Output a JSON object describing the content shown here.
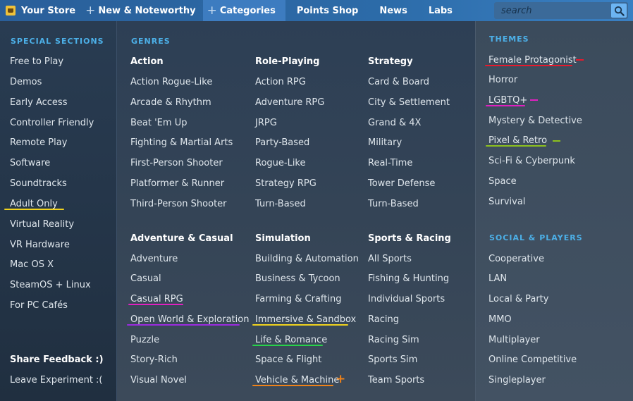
{
  "colors": {
    "yellow": "#f0d21e",
    "red": "#e8192c",
    "magenta": "#e020c0",
    "purple": "#9b2be0",
    "green": "#28d24a",
    "orange": "#f08218",
    "olive": "#8cc01e"
  },
  "topnav": {
    "store_label": "Your Store",
    "new_label": "New & Noteworthy",
    "categories_label": "Categories",
    "points_label": "Points Shop",
    "news_label": "News",
    "labs_label": "Labs",
    "search_placeholder": "search"
  },
  "special": {
    "heading": "SPECIAL SECTIONS",
    "items": [
      "Free to Play",
      "Demos",
      "Early Access",
      "Controller Friendly",
      "Remote Play",
      "Software",
      "Soundtracks",
      "Adult Only",
      "Virtual Reality",
      "VR Hardware",
      "Mac OS X",
      "SteamOS + Linux",
      "For PC Cafés"
    ],
    "share_feedback": "Share Feedback :)",
    "leave_experiment": "Leave Experiment :("
  },
  "genres": {
    "heading": "GENRES",
    "action": {
      "title": "Action",
      "items": [
        "Action Rogue-Like",
        "Arcade & Rhythm",
        "Beat 'Em Up",
        "Fighting & Martial Arts",
        "First-Person Shooter",
        "Platformer & Runner",
        "Third-Person Shooter"
      ]
    },
    "roleplaying": {
      "title": "Role-Playing",
      "items": [
        "Action RPG",
        "Adventure RPG",
        "JRPG",
        "Party-Based",
        "Rogue-Like",
        "Strategy RPG",
        "Turn-Based"
      ]
    },
    "strategy": {
      "title": "Strategy",
      "items": [
        "Card & Board",
        "City & Settlement",
        "Grand & 4X",
        "Military",
        "Real-Time",
        "Tower Defense",
        "Turn-Based"
      ]
    },
    "adventure": {
      "title": "Adventure & Casual",
      "items": [
        "Adventure",
        "Casual",
        "Casual RPG",
        "Open World & Exploration",
        "Puzzle",
        "Story-Rich",
        "Visual Novel"
      ]
    },
    "simulation": {
      "title": "Simulation",
      "items": [
        "Building & Automation",
        "Business & Tycoon",
        "Farming & Crafting",
        "Immersive & Sandbox",
        "Life & Romance",
        "Space & Flight",
        "Vehicle & Machine"
      ]
    },
    "sports": {
      "title": "Sports & Racing",
      "items": [
        "All Sports",
        "Fishing & Hunting",
        "Individual Sports",
        "Racing",
        "Racing Sim",
        "Sports Sim",
        "Team Sports"
      ]
    }
  },
  "themes": {
    "heading": "THEMES",
    "items": [
      "Female Protagonist",
      "Horror",
      "LGBTQ+",
      "Mystery & Detective",
      "Pixel & Retro",
      "Sci-Fi & Cyberpunk",
      "Space",
      "Survival"
    ]
  },
  "social": {
    "heading": "SOCIAL & PLAYERS",
    "items": [
      "Cooperative",
      "LAN",
      "Local & Party",
      "MMO",
      "Multiplayer",
      "Online Competitive",
      "Singleplayer"
    ]
  }
}
